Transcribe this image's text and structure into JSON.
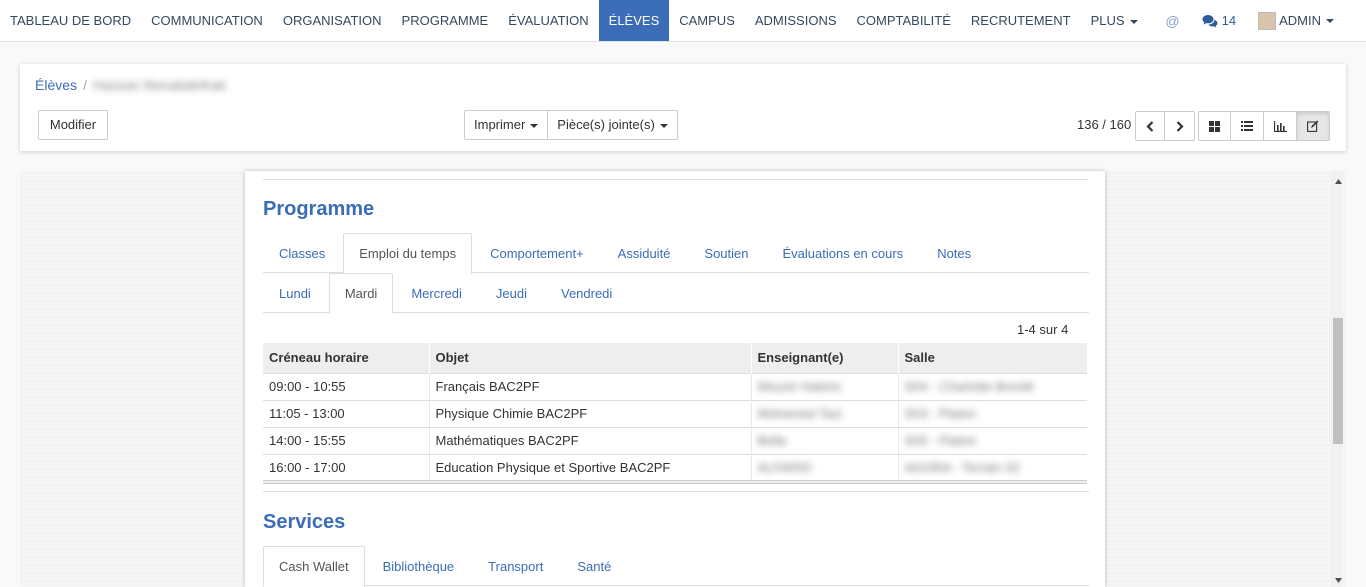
{
  "nav": {
    "items": [
      {
        "label": "TABLEAU DE BORD",
        "name": "nav-tableau-de-bord"
      },
      {
        "label": "COMMUNICATION",
        "name": "nav-communication"
      },
      {
        "label": "ORGANISATION",
        "name": "nav-organisation"
      },
      {
        "label": "PROGRAMME",
        "name": "nav-programme"
      },
      {
        "label": "ÉVALUATION",
        "name": "nav-evaluation"
      },
      {
        "label": "ÉLÈVES",
        "name": "nav-eleves"
      },
      {
        "label": "CAMPUS",
        "name": "nav-campus"
      },
      {
        "label": "ADMISSIONS",
        "name": "nav-admissions"
      },
      {
        "label": "COMPTABILITÉ",
        "name": "nav-comptabilite"
      },
      {
        "label": "RECRUTEMENT",
        "name": "nav-recrutement"
      },
      {
        "label": "PLUS",
        "name": "nav-plus"
      }
    ],
    "active_index": 5,
    "at_symbol": "@",
    "messages_count": "14",
    "user_label": "ADMIN",
    "accent_color": "#3b6cb7"
  },
  "breadcrumb": {
    "root": "Élèves",
    "separator": "/",
    "current": "Hassan Benabdelhak"
  },
  "toolbar": {
    "edit_label": "Modifier",
    "print_label": "Imprimer",
    "attachments_label": "Pièce(s) jointe(s)",
    "pager_text": "136 / 160",
    "prev_icon": "chevron-left-icon",
    "next_icon": "chevron-right-icon",
    "views": [
      "kanban-icon",
      "list-icon",
      "graph-icon",
      "form-edit-icon"
    ],
    "active_view": 3
  },
  "programme": {
    "title": "Programme",
    "tabs": [
      "Classes",
      "Emploi du temps",
      "Comportement+",
      "Assiduité",
      "Soutien",
      "Évaluations en cours",
      "Notes"
    ],
    "active_tab": 1,
    "day_tabs": [
      "Lundi",
      "Mardi",
      "Mercredi",
      "Jeudi",
      "Vendredi"
    ],
    "active_day": 1,
    "count": "1-4 sur 4",
    "columns": [
      "Créneau horaire",
      "Objet",
      "Enseignant(e)",
      "Salle"
    ],
    "rows": [
      {
        "slot": "09:00 - 10:55",
        "subject": "Français BAC2PF",
        "teacher": "Mounir Hakimi",
        "room": "S04 - Charlotte Brontë"
      },
      {
        "slot": "11:05 - 13:00",
        "subject": "Physique Chimie BAC2PF",
        "teacher": "Mohamed Tazi",
        "room": "S03 - Platon"
      },
      {
        "slot": "14:00 - 15:55",
        "subject": "Mathématiques BAC2PF",
        "teacher": "Bella",
        "room": "S05 - Platon"
      },
      {
        "slot": "16:00 - 17:00",
        "subject": "Education Physique et Sportive BAC2PF",
        "teacher": "ALFARID",
        "room": "AGORA - Terrain 02"
      }
    ]
  },
  "services": {
    "title": "Services",
    "tabs": [
      "Cash Wallet",
      "Bibliothèque",
      "Transport",
      "Santé"
    ],
    "active_tab": 0
  }
}
